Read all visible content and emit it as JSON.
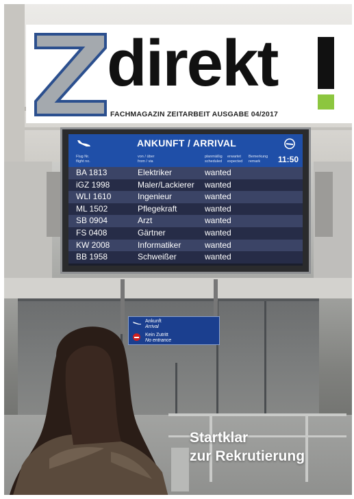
{
  "masthead": {
    "logo_letter": "Z",
    "logo_word": "direkt",
    "logo_mark": "!",
    "subtitle": "FACHMAGAZIN ZEITARBEIT AUSGABE 04/2017",
    "colors": {
      "z_fill": "#a4a9ae",
      "z_outline": "#2b4f8e",
      "word": "#111111",
      "accent_green": "#8cc63f"
    }
  },
  "board": {
    "title": "ANKUNFT / ARRIVAL",
    "time": "11:50",
    "plane_icon": "plane-landing-icon",
    "no_plane_icon": "no-plane-icon",
    "columns": {
      "flight": [
        "Flug Nr.",
        "flight no."
      ],
      "from": [
        "von / über",
        "from / via"
      ],
      "scheduled": [
        "planmäßig",
        "scheduled"
      ],
      "expected": [
        "erwartet",
        "expected"
      ],
      "remark": [
        "Bemerkung",
        "remark"
      ]
    },
    "rows": [
      {
        "flight": "BA 1813",
        "from": "Elektriker",
        "status": "wanted"
      },
      {
        "flight": "iGZ 1998",
        "from": "Maler/Lackierer",
        "status": "wanted"
      },
      {
        "flight": "WLI 1610",
        "from": "Ingenieur",
        "status": "wanted"
      },
      {
        "flight": "ML 1502",
        "from": "Pflegekraft",
        "status": "wanted"
      },
      {
        "flight": "SB 0904",
        "from": "Arzt",
        "status": "wanted"
      },
      {
        "flight": "FS 0408",
        "from": "Gärtner",
        "status": "wanted"
      },
      {
        "flight": "KW 2008",
        "from": "Informatiker",
        "status": "wanted"
      },
      {
        "flight": "BB 1958",
        "from": "Schweißer",
        "status": "wanted"
      }
    ]
  },
  "sign": {
    "arrival_de": "Ankunft",
    "arrival_en": "Arrival",
    "no_entry_de": "Kein Zutritt",
    "no_entry_en": "No entrance"
  },
  "headline": {
    "line1": "Startklar",
    "line2": "zur Rekrutierung"
  }
}
